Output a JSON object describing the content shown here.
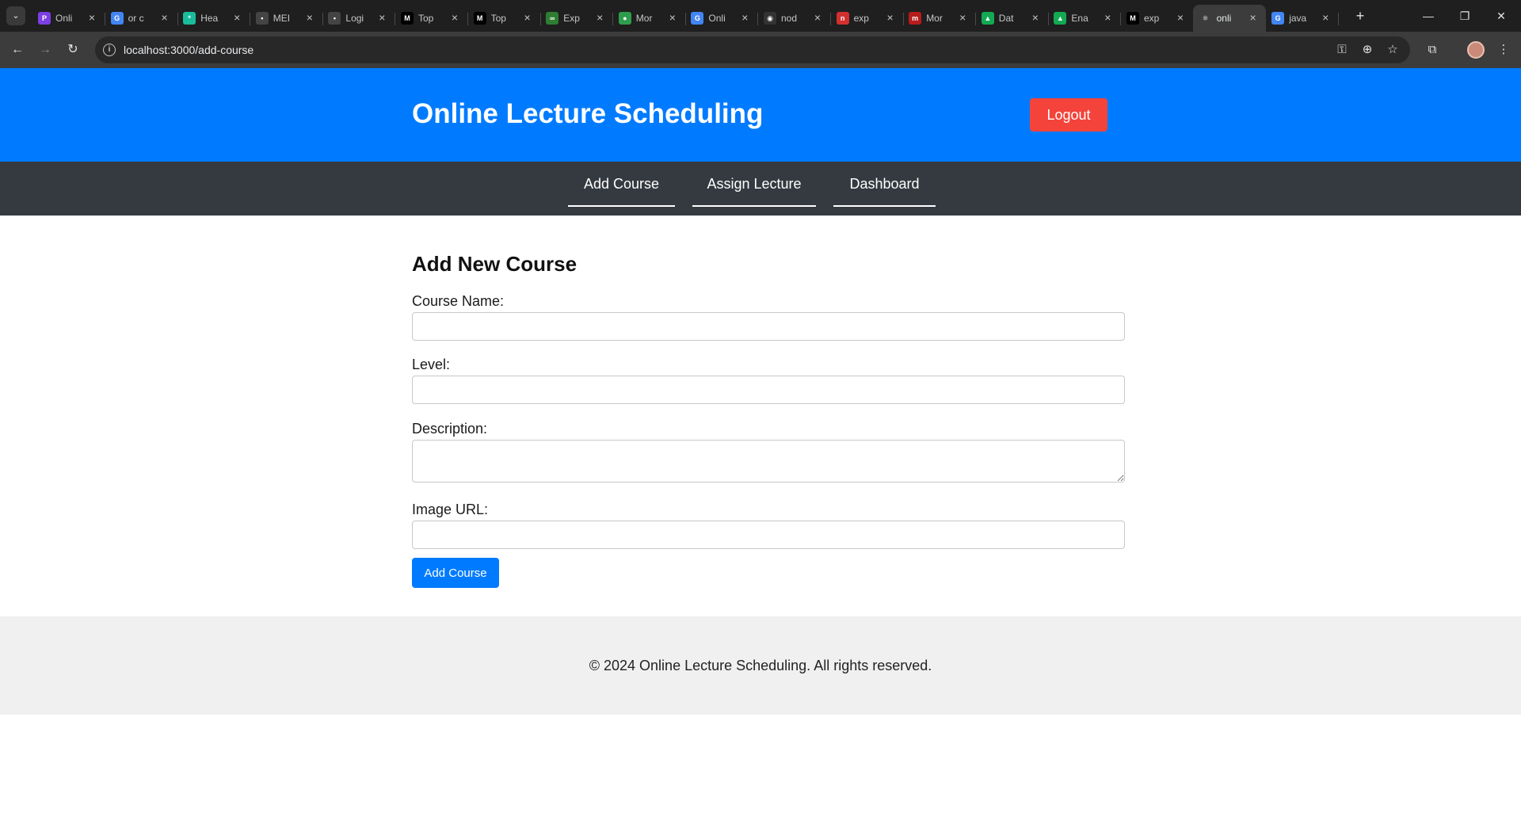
{
  "browser": {
    "tabs": [
      {
        "title": "Onli",
        "icon": "purple-logo-icon",
        "color": "#7b3fe4",
        "glyph": "P"
      },
      {
        "title": "or c",
        "icon": "google-icon",
        "color": "#4285f4",
        "glyph": "G"
      },
      {
        "title": "Hea",
        "icon": "asterisk-logo-icon",
        "color": "#1abc9c",
        "glyph": "*"
      },
      {
        "title": "MEI",
        "icon": "leaf-logo-icon",
        "color": "#444444",
        "glyph": "•"
      },
      {
        "title": "Logi",
        "icon": "leaf-logo-icon",
        "color": "#444444",
        "glyph": "•"
      },
      {
        "title": "Top",
        "icon": "medium-icon",
        "color": "#000000",
        "glyph": "M"
      },
      {
        "title": "Top",
        "icon": "medium-icon",
        "color": "#000000",
        "glyph": "M"
      },
      {
        "title": "Exp",
        "icon": "link-logo-icon",
        "color": "#2e7d32",
        "glyph": "∞"
      },
      {
        "title": "Mor",
        "icon": "green-logo-icon",
        "color": "#2e9d4c",
        "glyph": "●"
      },
      {
        "title": "Onli",
        "icon": "google-icon",
        "color": "#4285f4",
        "glyph": "G"
      },
      {
        "title": "nod",
        "icon": "github-icon",
        "color": "#333333",
        "glyph": "◉"
      },
      {
        "title": "exp",
        "icon": "red-logo-icon",
        "color": "#d32f2f",
        "glyph": "n"
      },
      {
        "title": "Mor",
        "icon": "red-logo-icon",
        "color": "#b71c1c",
        "glyph": "m"
      },
      {
        "title": "Dat",
        "icon": "mongodb-leaf-icon",
        "color": "#13aa52",
        "glyph": "▲"
      },
      {
        "title": "Ena",
        "icon": "mongodb-leaf-icon",
        "color": "#13aa52",
        "glyph": "▲"
      },
      {
        "title": "exp",
        "icon": "medium-icon",
        "color": "#000000",
        "glyph": "M"
      },
      {
        "title": "onli",
        "icon": "react-icon",
        "color": "#3c3c3c",
        "glyph": "⚛"
      },
      {
        "title": "java",
        "icon": "google-icon",
        "color": "#4285f4",
        "glyph": "G"
      }
    ],
    "active_tab_index": 16,
    "url": "localhost:3000/add-course"
  },
  "header": {
    "title": "Online Lecture Scheduling",
    "logout_label": "Logout",
    "bg_color": "#007bff",
    "logout_color": "#f4433b"
  },
  "nav": {
    "items": [
      {
        "label": "Add Course"
      },
      {
        "label": "Assign Lecture"
      },
      {
        "label": "Dashboard"
      }
    ]
  },
  "form": {
    "title": "Add New Course",
    "course_name_label": "Course Name:",
    "course_name_value": "",
    "level_label": "Level:",
    "level_value": "",
    "description_label": "Description:",
    "description_value": "",
    "image_url_label": "Image URL:",
    "image_url_value": "",
    "submit_label": "Add Course"
  },
  "footer": {
    "text": "© 2024 Online Lecture Scheduling. All rights reserved."
  }
}
